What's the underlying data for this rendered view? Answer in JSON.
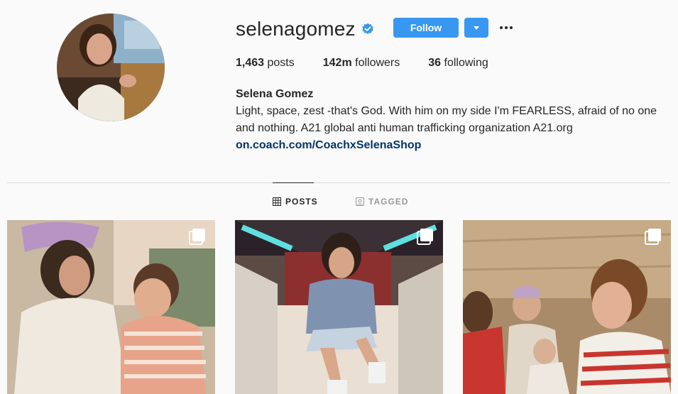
{
  "profile": {
    "username": "selenagomez",
    "verified": true,
    "follow_label": "Follow",
    "posts_count": "1,463",
    "posts_label": "posts",
    "followers_count": "142m",
    "followers_label": "followers",
    "following_count": "36",
    "following_label": "following",
    "full_name": "Selena Gomez",
    "bio": "Light, space, zest -that's God. With him on my side I'm FEARLESS, afraid of no one and nothing. A21 global anti human trafficking organization A21.org",
    "link": "on.coach.com/CoachxSelenaShop"
  },
  "tabs": [
    {
      "label": "POSTS",
      "icon": "grid-icon",
      "active": true
    },
    {
      "label": "TAGGED",
      "icon": "tagged-icon",
      "active": false
    }
  ],
  "posts": [
    {
      "icon": "multiple-photos-icon"
    },
    {
      "icon": "multiple-photos-icon"
    },
    {
      "icon": "multiple-photos-icon"
    }
  ],
  "colors": {
    "accent": "#3897f0",
    "link": "#003569",
    "verified": "#3897f0"
  }
}
